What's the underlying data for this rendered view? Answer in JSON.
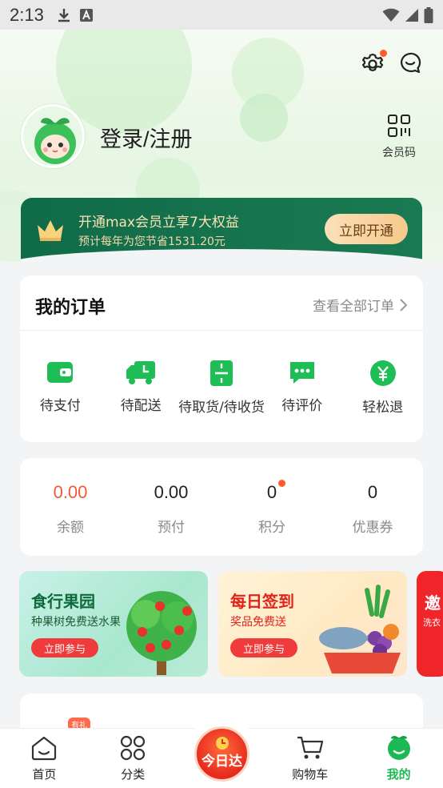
{
  "status_bar": {
    "time": "2:13"
  },
  "profile": {
    "login_label": "登录/注册",
    "member_code_label": "会员码"
  },
  "vip": {
    "title": "开通max会员立享7大权益",
    "subtitle": "预计每年为您节省1531.20元",
    "button": "立即开通"
  },
  "orders": {
    "title": "我的订单",
    "view_all": "查看全部订单",
    "items": [
      {
        "label": "待支付",
        "icon": "wallet-icon"
      },
      {
        "label": "待配送",
        "icon": "delivery-truck-icon"
      },
      {
        "label": "待取货/待收货",
        "icon": "pickup-box-icon"
      },
      {
        "label": "待评价",
        "icon": "comment-icon"
      },
      {
        "label": "轻松退",
        "icon": "refund-icon"
      }
    ]
  },
  "wallet": {
    "items": [
      {
        "value": "0.00",
        "label": "余额"
      },
      {
        "value": "0.00",
        "label": "预付"
      },
      {
        "value": "0",
        "label": "积分"
      },
      {
        "value": "0",
        "label": "优惠券"
      }
    ]
  },
  "promos": [
    {
      "title": "食行果园",
      "subtitle": "种果树免费送水果",
      "button": "立即参与"
    },
    {
      "title": "每日签到",
      "subtitle": "奖品免费送",
      "button": "立即参与"
    },
    {
      "title": "邀",
      "subtitle": "洗衣"
    }
  ],
  "partial_tag": "有礼",
  "tabbar": {
    "tabs": [
      {
        "label": "首页"
      },
      {
        "label": "分类"
      },
      {
        "label": "今日达"
      },
      {
        "label": "购物车"
      },
      {
        "label": "我的"
      }
    ]
  },
  "colors": {
    "brand_green": "#1db954",
    "vip_green": "#106b48",
    "accent_red": "#f05a3a",
    "vip_gold": "#f5c98c"
  }
}
